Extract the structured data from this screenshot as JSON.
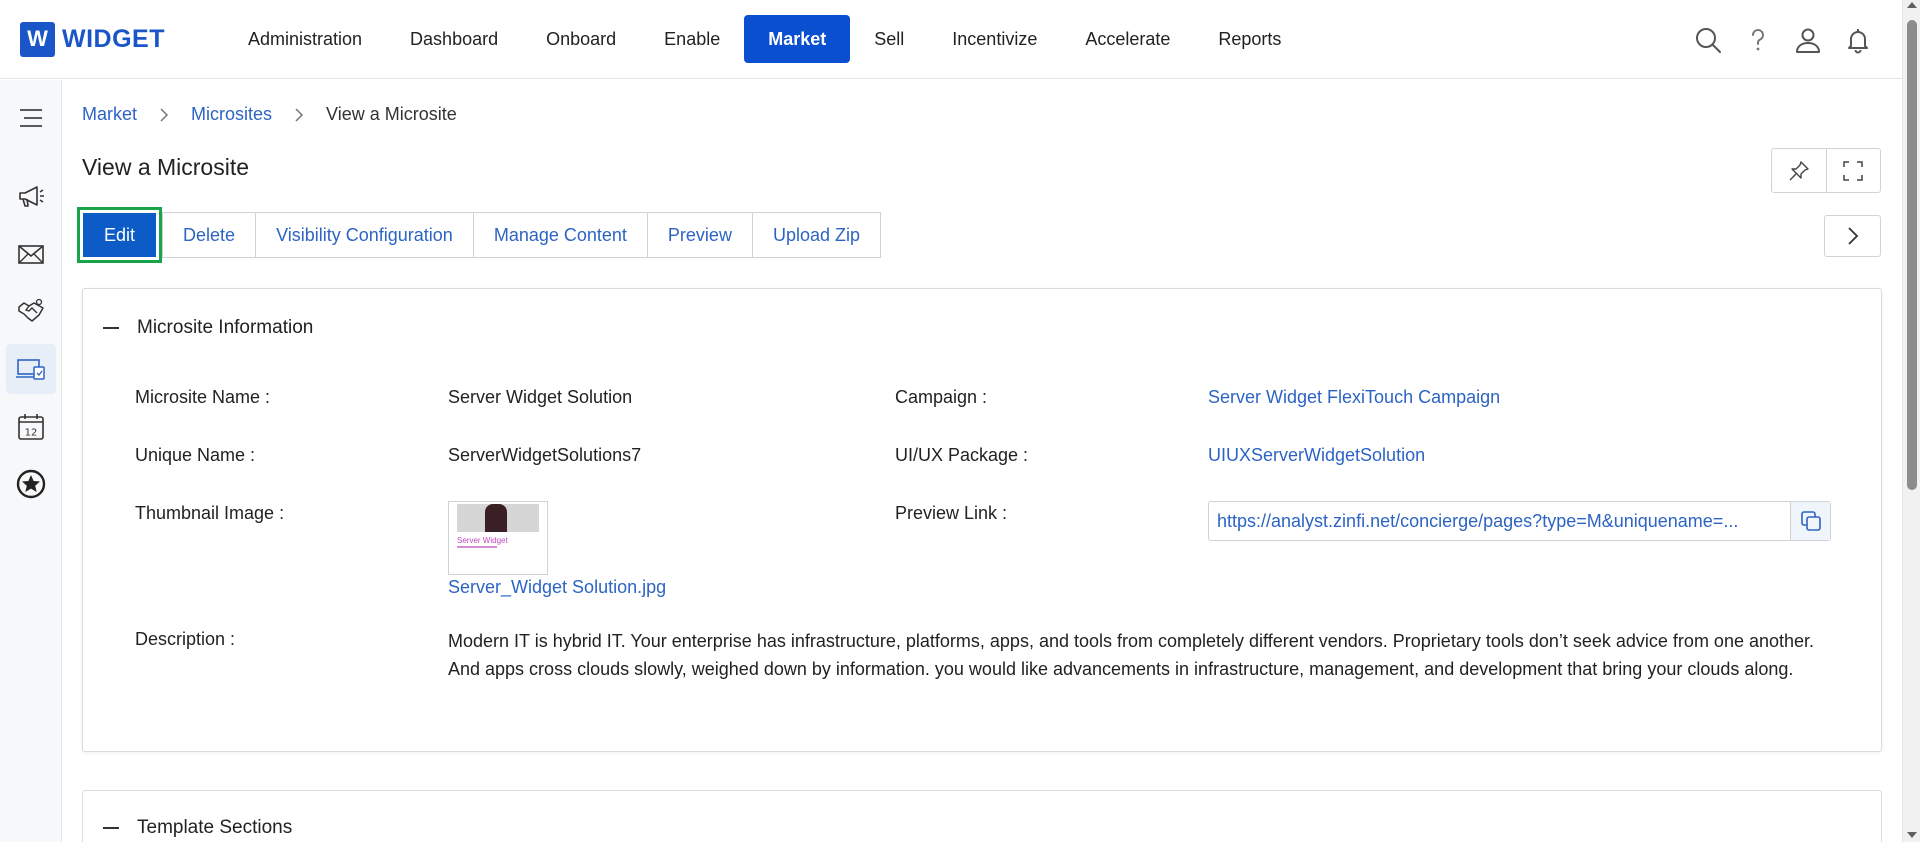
{
  "header": {
    "logo_letter": "W",
    "logo_text": "WIDGET",
    "nav": [
      "Administration",
      "Dashboard",
      "Onboard",
      "Enable",
      "Market",
      "Sell",
      "Incentivize",
      "Accelerate",
      "Reports"
    ],
    "active_nav": "Market",
    "icons": [
      "search-icon",
      "help-icon",
      "user-icon",
      "bell-icon"
    ]
  },
  "sidebar": {
    "items": [
      "menu-icon",
      "megaphone-icon",
      "mail-icon",
      "handshake-icon",
      "microsite-icon",
      "calendar-icon",
      "star-badge-icon"
    ],
    "active": "microsite-icon",
    "calendar_day": "12"
  },
  "breadcrumb": {
    "items": [
      "Market",
      "Microsites"
    ],
    "current": "View a Microsite"
  },
  "page": {
    "title": "View a Microsite"
  },
  "actions": {
    "edit": "Edit",
    "delete": "Delete",
    "visibility": "Visibility Configuration",
    "manage_content": "Manage Content",
    "preview": "Preview",
    "upload_zip": "Upload Zip"
  },
  "section": {
    "title": "Microsite Information",
    "fields": {
      "name_label": "Microsite Name :",
      "name_value": "Server Widget Solution",
      "unique_label": "Unique Name :",
      "unique_value": "ServerWidgetSolutions7",
      "thumb_label": "Thumbnail Image :",
      "thumb_file": "Server_Widget Solution.jpg",
      "thumb_caption": "Server Widget",
      "campaign_label": "Campaign :",
      "campaign_value": "Server Widget FlexiTouch Campaign",
      "uiux_label": "UI/UX Package :",
      "uiux_value": "UIUXServerWidgetSolution",
      "preview_label": "Preview Link :",
      "preview_value": "https://analyst.zinfi.net/concierge/pages?type=M&uniquename=...",
      "desc_label": "Description :",
      "desc_value": "Modern IT is hybrid IT. Your enterprise has infrastructure, platforms, apps, and tools from completely different vendors. Proprietary tools don’t seek advice from one another. And apps cross clouds slowly, weighed down by information. you would like advancements in infrastructure, management, and development that bring your clouds along."
    }
  },
  "section2": {
    "title": "Template Sections"
  },
  "colors": {
    "accent": "#0a4fd0",
    "link": "#2d64c4",
    "highlight": "#19a34a"
  }
}
